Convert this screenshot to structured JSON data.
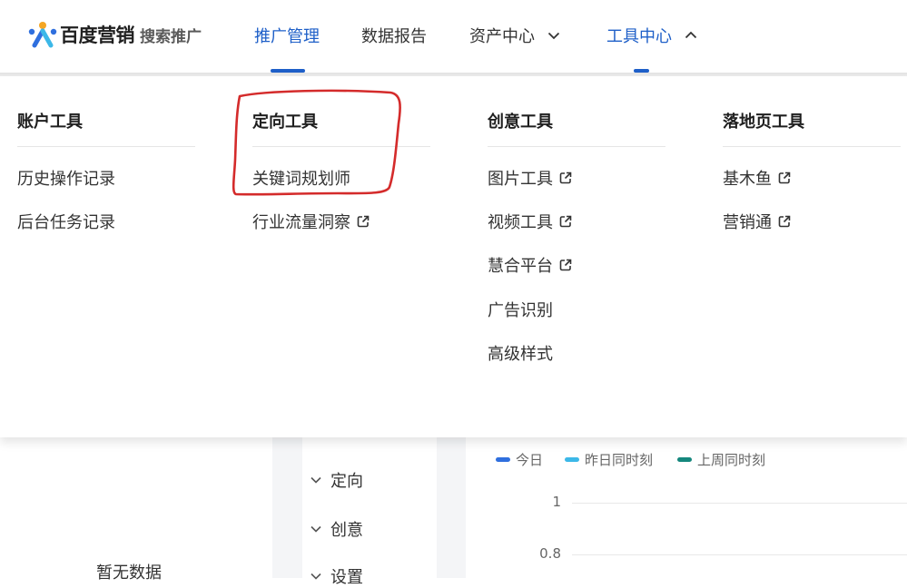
{
  "header": {
    "logo_text": "百度营销",
    "logo_sub": "搜索推广",
    "nav": [
      {
        "label": "推广管理",
        "active": true
      },
      {
        "label": "数据报告"
      },
      {
        "label": "资产中心"
      },
      {
        "label": "工具中心",
        "open": true
      }
    ]
  },
  "dropdown": {
    "columns": [
      {
        "title": "账户工具",
        "items": [
          {
            "label": "历史操作记录"
          },
          {
            "label": "后台任务记录"
          }
        ]
      },
      {
        "title": "定向工具",
        "items": [
          {
            "label": "关键词规划师",
            "annotated": true
          },
          {
            "label": "行业流量洞察",
            "external": true
          }
        ]
      },
      {
        "title": "创意工具",
        "items": [
          {
            "label": "图片工具",
            "external": true
          },
          {
            "label": "视频工具",
            "external": true
          },
          {
            "label": "慧合平台",
            "external": true
          },
          {
            "label": "广告识别"
          },
          {
            "label": "高级样式"
          }
        ]
      },
      {
        "title": "落地页工具",
        "items": [
          {
            "label": "基木鱼",
            "external": true
          },
          {
            "label": "营销通",
            "external": true
          }
        ]
      }
    ]
  },
  "background_page": {
    "empty_text": "暂无数据",
    "side_items": [
      {
        "label": "定向"
      },
      {
        "label": "创意"
      },
      {
        "label": "设置"
      }
    ],
    "legend": [
      {
        "label": "今日",
        "color": "#2f6fde"
      },
      {
        "label": "昨日同时刻",
        "color": "#3cb8e8"
      },
      {
        "label": "上周同时刻",
        "color": "#15877d"
      }
    ],
    "y_ticks": [
      "1",
      "0.8"
    ]
  },
  "colors": {
    "accent": "#1e5fc8",
    "annotation": "#d42b2b"
  }
}
